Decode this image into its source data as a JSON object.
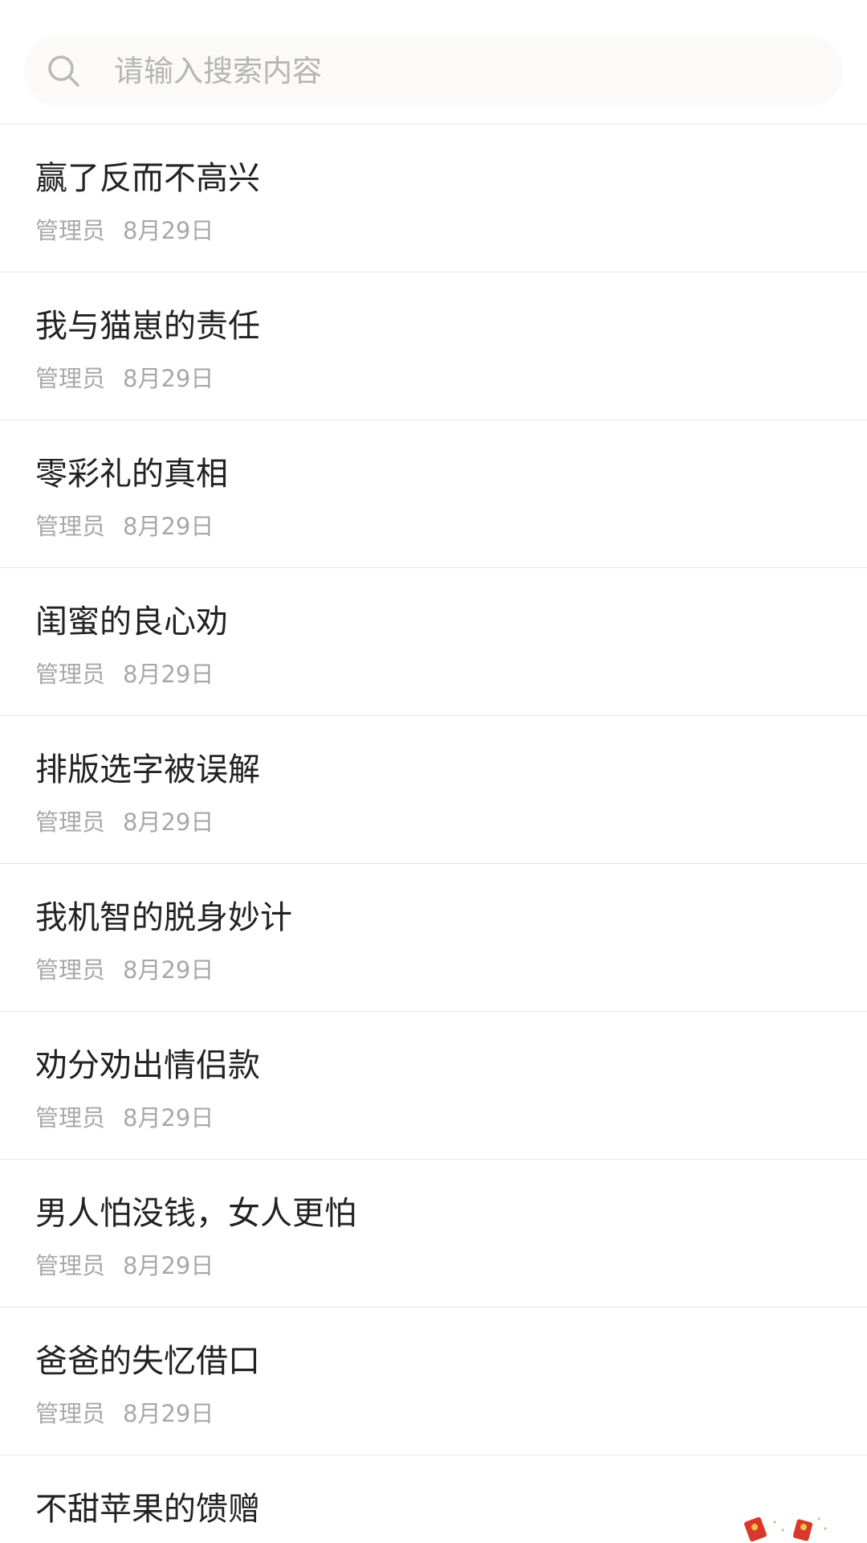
{
  "search": {
    "placeholder": "请输入搜索内容",
    "icon": "search-icon"
  },
  "articles": [
    {
      "title": "赢了反而不高兴",
      "author": "管理员",
      "date": "8月29日"
    },
    {
      "title": "我与猫崽的责任",
      "author": "管理员",
      "date": "8月29日"
    },
    {
      "title": "零彩礼的真相",
      "author": "管理员",
      "date": "8月29日"
    },
    {
      "title": "闺蜜的良心劝",
      "author": "管理员",
      "date": "8月29日"
    },
    {
      "title": "排版选字被误解",
      "author": "管理员",
      "date": "8月29日"
    },
    {
      "title": "我机智的脱身妙计",
      "author": "管理员",
      "date": "8月29日"
    },
    {
      "title": "劝分劝出情侣款",
      "author": "管理员",
      "date": "8月29日"
    },
    {
      "title": "男人怕没钱，女人更怕",
      "author": "管理员",
      "date": "8月29日"
    },
    {
      "title": "爸爸的失忆借口",
      "author": "管理员",
      "date": "8月29日"
    },
    {
      "title": "不甜苹果的馈赠",
      "author": "",
      "date": ""
    }
  ],
  "colors": {
    "title": "#222222",
    "meta": "#a8a8a8",
    "divider": "#e6e6e6",
    "search_bg": "#fbfaf8"
  }
}
